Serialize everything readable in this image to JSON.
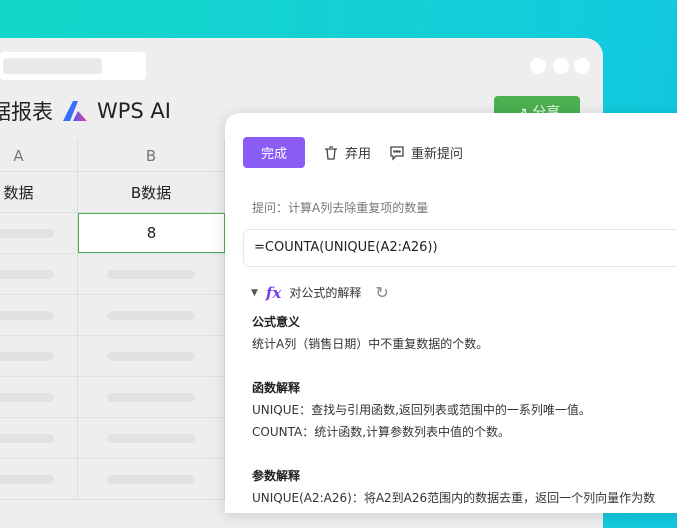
{
  "sheet": {
    "title": "据报表",
    "brand": "WPS AI",
    "share_label": "分享",
    "columns": [
      "A",
      "B"
    ],
    "header_row": [
      "数据",
      "B数据"
    ],
    "selected_value": "8"
  },
  "panel": {
    "done_label": "完成",
    "discard_label": "弃用",
    "reask_label": "重新提问",
    "prompt": "提问：计算A列去除重复项的数量",
    "formula": "=COUNTA(UNIQUE(A2:A26))",
    "explain_title": "对公式的解释",
    "sections": [
      {
        "title": "公式意义",
        "lines": [
          "统计A列（销售日期）中不重复数据的个数。"
        ]
      },
      {
        "title": "函数解释",
        "lines": [
          "UNIQUE：查找与引用函数,返回列表或范围中的一系列唯一值。",
          "COUNTA：统计函数,计算参数列表中值的个数。"
        ]
      },
      {
        "title": "参数解释",
        "lines": [
          "UNIQUE(A2:A26)：将A2到A26范围内的数据去重，返回一个列向量作为数"
        ]
      }
    ]
  },
  "colors": {
    "accent": "#8b5cf6",
    "share": "#4caf50"
  }
}
